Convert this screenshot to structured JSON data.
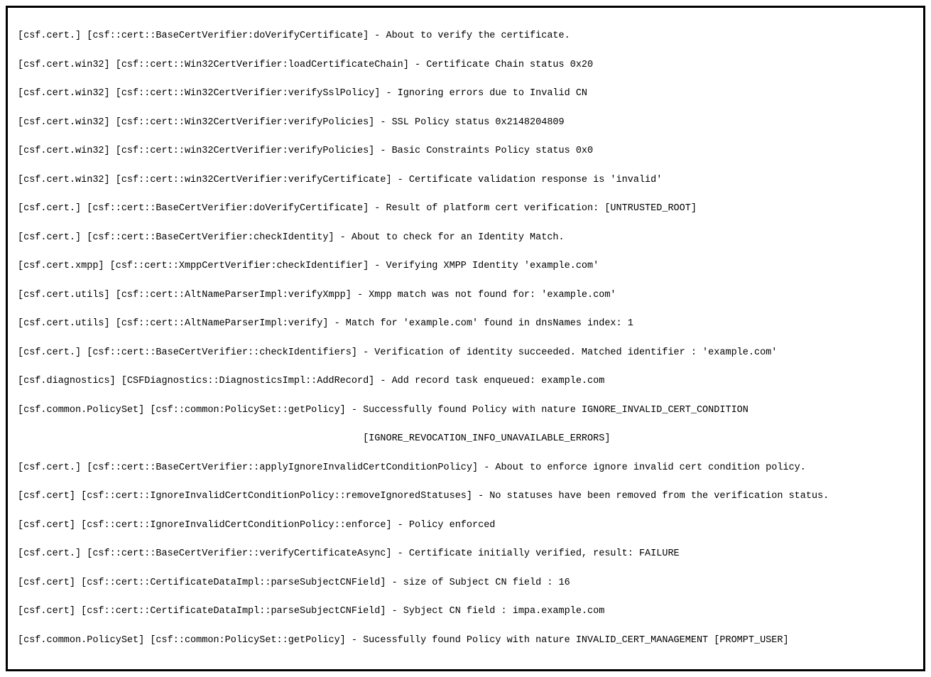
{
  "log_lines": [
    "[csf.cert.] [csf::cert::BaseCertVerifier:doVerifyCertificate] - About to verify the certificate.",
    "[csf.cert.win32] [csf::cert::Win32CertVerifier:loadCertificateChain] - Certificate Chain status 0x20",
    "[csf.cert.win32] [csf::cert::Win32CertVerifier:verifySslPolicy] - Ignoring errors due to Invalid CN",
    "[csf.cert.win32] [csf::cert::Win32CertVerifier:verifyPolicies] - SSL Policy status 0x2148204809",
    "[csf.cert.win32] [csf::cert::win32CertVerifier:verifyPolicies] - Basic Constraints Policy status 0x0",
    "[csf.cert.win32] [csf::cert::win32CertVerifier:verifyCertificate] - Certificate validation response is 'invalid'",
    "[csf.cert.] [csf::cert::BaseCertVerifier:doVerifyCertificate] - Result of platform cert verification: [UNTRUSTED_ROOT]",
    "[csf.cert.] [csf::cert::BaseCertVerifier:checkIdentity] - About to check for an Identity Match.",
    "[csf.cert.xmpp] [csf::cert::XmppCertVerifier:checkIdentifier] - Verifying XMPP Identity 'example.com'",
    "[csf.cert.utils] [csf::cert::AltNameParserImpl:verifyXmpp] - Xmpp match was not found for: 'example.com'",
    "[csf.cert.utils] [csf::cert::AltNameParserImpl:verify] - Match for 'example.com' found in dnsNames index: 1",
    "[csf.cert.] [csf::cert::BaseCertVerifier::checkIdentifiers] - Verification of identity succeeded. Matched identifier : 'example.com'",
    "[csf.diagnostics] [CSFDiagnostics::DiagnosticsImpl::AddRecord] - Add record task enqueued: example.com",
    "[csf.common.PolicySet] [csf::common:PolicySet::getPolicy] - Successfully found Policy with nature IGNORE_INVALID_CERT_CONDITION",
    "                                                            [IGNORE_REVOCATION_INFO_UNAVAILABLE_ERRORS]",
    "[csf.cert.] [csf::cert::BaseCertVerifier::applyIgnoreInvalidCertConditionPolicy] - About to enforce ignore invalid cert condition policy.",
    "[csf.cert] [csf::cert::IgnoreInvalidCertConditionPolicy::removeIgnoredStatuses] - No statuses have been removed from the verification status.",
    "[csf.cert] [csf::cert::IgnoreInvalidCertConditionPolicy::enforce] - Policy enforced",
    "[csf.cert.] [csf::cert::BaseCertVerifier::verifyCertificateAsync] - Certificate initially verified, result: FAILURE",
    "[csf.cert] [csf::cert::CertificateDataImpl::parseSubjectCNField] - size of Subject CN field : 16",
    "[csf.cert] [csf::cert::CertificateDataImpl::parseSubjectCNField] - Sybject CN field : impa.example.com",
    "[csf.common.PolicySet] [csf::common:PolicySet::getPolicy] - Sucessfully found Policy with nature INVALID_CERT_MANAGEMENT [PROMPT_USER]"
  ]
}
